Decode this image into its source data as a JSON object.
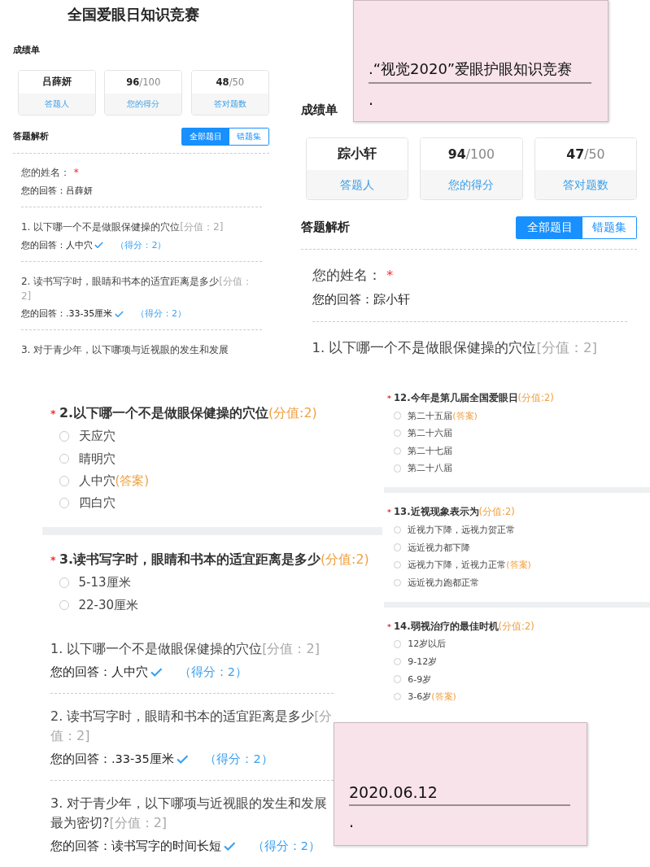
{
  "panels": [
    {
      "kind": "result",
      "title": "全国爱眼日知识竞赛",
      "section_title": "成绩单",
      "cards": [
        {
          "value": "吕薛妍",
          "label": "答题人"
        },
        {
          "value": "96",
          "total": "/100",
          "label": "您的得分"
        },
        {
          "value": "48",
          "total": "/50",
          "label": "答对题数"
        }
      ],
      "analysis_title": "答题解析",
      "tabs": [
        {
          "label": "全部题目",
          "selected": true
        },
        {
          "label": "错题集",
          "selected": false
        }
      ],
      "items": [
        {
          "question": "您的姓名：",
          "required_mark": "*",
          "answer_label": "您的回答：",
          "answer": "吕薛妍"
        },
        {
          "question": "1. 以下哪一个不是做眼保健操的穴位",
          "points": "[分值：2]",
          "answer_label": "您的回答：",
          "answer": "人中穴",
          "correct": true,
          "score": "（得分：2）"
        },
        {
          "question": "2. 读书写字时，眼睛和书本的适宜距离是多少",
          "points": "[分值：2]",
          "answer_label": "您的回答：",
          "answer": ".33-35厘米",
          "correct": true,
          "score": "（得分：2）"
        },
        {
          "question": "3. 对于青少年，以下哪项与近视眼的发生和发展"
        }
      ]
    },
    {
      "kind": "note",
      "lines": [
        ".“视觉2020”爱眼护眼知识竞赛",
        "."
      ]
    },
    {
      "kind": "result",
      "section_title": "成绩单",
      "cards": [
        {
          "value": "踪小轩",
          "label": "答题人"
        },
        {
          "value": "94",
          "total": "/100",
          "label": "您的得分"
        },
        {
          "value": "47",
          "total": "/50",
          "label": "答对题数"
        }
      ],
      "analysis_title": "答题解析",
      "tabs": [
        {
          "label": "全部题目",
          "selected": true
        },
        {
          "label": "错题集",
          "selected": false
        }
      ],
      "items": [
        {
          "question": "您的姓名：",
          "required_mark": "*",
          "answer_label": "您的回答：",
          "answer": "踪小轩"
        },
        {
          "question": "1. 以下哪一个不是做眼保健操的穴位",
          "points": "[分值：2]"
        }
      ]
    },
    {
      "kind": "quiz",
      "questions": [
        {
          "title": "2.以下哪一个不是做眼保健操的穴位",
          "points": "(分值:2)",
          "required_mark": "*",
          "options": [
            {
              "text": "天应穴",
              "selected": false
            },
            {
              "text": "睛明穴",
              "selected": false
            },
            {
              "text": "人中穴",
              "answer_tag": "(答案)",
              "selected": false
            },
            {
              "text": "四白穴",
              "selected": false
            }
          ]
        },
        {
          "title": "3.读书写字时，眼睛和书本的适宜距离是多少",
          "points": "(分值:2)",
          "required_mark": "*",
          "options": [
            {
              "text": "5-13厘米",
              "selected": false
            },
            {
              "text": "22-30厘米",
              "selected": false
            }
          ]
        }
      ]
    },
    {
      "kind": "quiz",
      "questions": [
        {
          "title": "12.今年是第几届全国爱眼日",
          "points": "(分值:2)",
          "required_mark": "*",
          "options": [
            {
              "text": "第二十五届",
              "answer_tag": "(答案)",
              "selected": false
            },
            {
              "text": "第二十六届",
              "selected": false
            },
            {
              "text": "第二十七届",
              "selected": false
            },
            {
              "text": "第二十八届",
              "selected": false
            }
          ]
        },
        {
          "title": "13.近视现象表示为",
          "points": "(分值:2)",
          "required_mark": "*",
          "options": [
            {
              "text": "近视力下降，远视力贺正常",
              "selected": false
            },
            {
              "text": "远近视力都下降",
              "selected": false
            },
            {
              "text": "远视力下降，近视力正常",
              "answer_tag": "(答案)",
              "selected": false
            },
            {
              "text": "远近视力跑都正常",
              "selected": false
            }
          ]
        },
        {
          "title": "14.弱视治疗的最佳时机",
          "points": "(分值:2)",
          "required_mark": "*",
          "options": [
            {
              "text": "12岁以后",
              "selected": false
            },
            {
              "text": "9-12岁",
              "selected": false
            },
            {
              "text": "6-9岁",
              "selected": false
            },
            {
              "text": "3-6岁",
              "answer_tag": "(答案)",
              "selected": false
            }
          ]
        }
      ]
    },
    {
      "kind": "answers",
      "items": [
        {
          "question": "1. 以下哪一个不是做眼保健操的穴位",
          "points": "[分值：2]",
          "answer_label": "您的回答：",
          "answer": "人中穴",
          "correct": true,
          "score": "（得分：2）"
        },
        {
          "question": "2. 读书写字时，眼睛和书本的适宜距离是多少",
          "points": "[分值：2]",
          "answer_label": "您的回答：",
          "answer": ".33-35厘米",
          "correct": true,
          "score": "（得分：2）"
        },
        {
          "question": "3. 对于青少年，以下哪项与近视眼的发生和发展最为密切?",
          "points": "[分值：2]",
          "answer_label": "您的回答：",
          "answer": "读书写字的时间长短",
          "correct": true,
          "score": "（得分：2）"
        }
      ]
    },
    {
      "kind": "note",
      "lines": [
        "2020.06.12",
        "."
      ]
    }
  ]
}
